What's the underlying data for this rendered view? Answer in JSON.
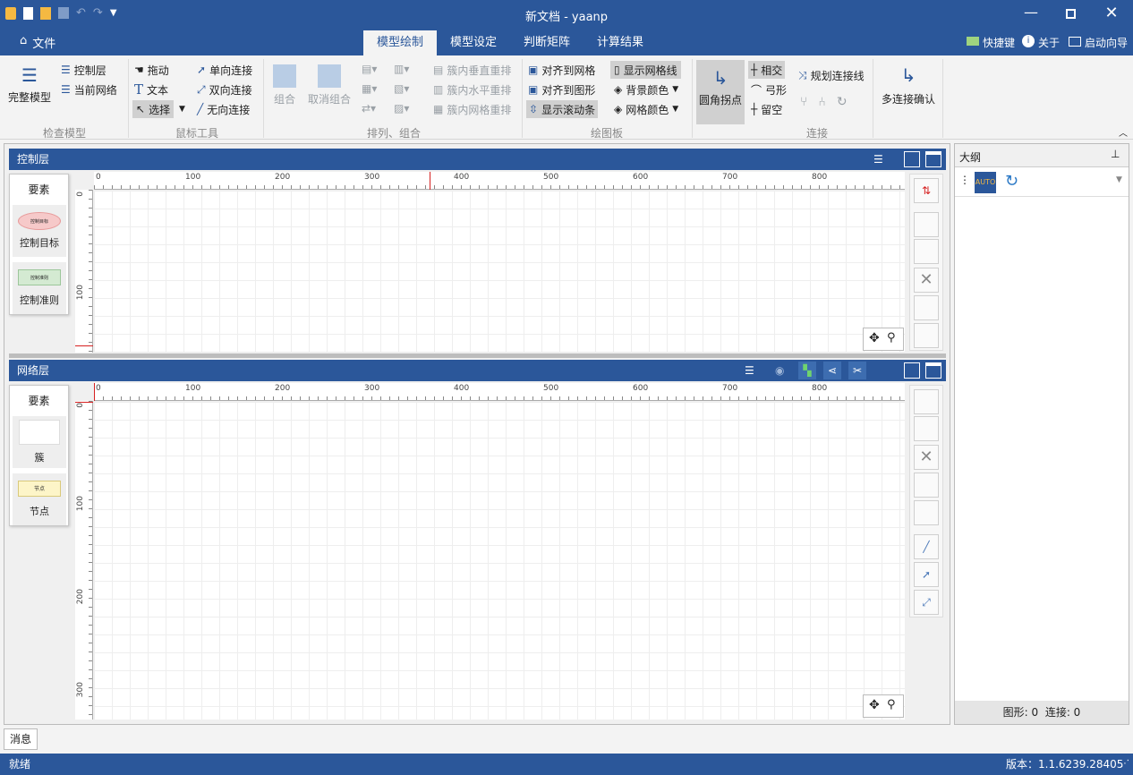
{
  "window": {
    "title": "新文档 - yaanp"
  },
  "tabs": {
    "file": "文件",
    "t1": "模型绘制",
    "t2": "模型设定",
    "t3": "判断矩阵",
    "t4": "计算结果",
    "shortcut": "快捷键",
    "about": "关于",
    "wizard": "启动向导"
  },
  "ribbon": {
    "check": {
      "complete": "完整模型",
      "ctrl_layer": "控制层",
      "cur_net": "当前网络",
      "label": "检查模型"
    },
    "mouse": {
      "drag": "拖动",
      "text": "文本",
      "select": "选择",
      "one_way": "单向连接",
      "two_way": "双向连接",
      "no_dir": "无向连接",
      "label": "鼠标工具"
    },
    "arrange": {
      "group": "组合",
      "ungroup": "取消组合",
      "vert": "簇内垂直重排",
      "horz": "簇内水平重排",
      "gridr": "簇内网格重排",
      "label": "排列、组合"
    },
    "canvas": {
      "align_grid": "对齐到网格",
      "align_shape": "对齐到图形",
      "show_scroll": "显示滚动条",
      "show_grid": "显示网格线",
      "bg_color": "背景颜色",
      "grid_color": "网格颜色",
      "label": "绘图板"
    },
    "connect": {
      "rounded": "圆角拐点",
      "intersect": "相交",
      "arc": "弓形",
      "gap": "留空",
      "plan": "规划连接线",
      "multi": "多连接确认",
      "label": "连接"
    }
  },
  "panels": {
    "control": {
      "title": "控制层",
      "elements": "要素",
      "item1": "控制目标",
      "item2": "控制准则",
      "shape1": "控制目标",
      "shape2": "控制准则"
    },
    "network": {
      "title": "网络层",
      "elements": "要素",
      "item1": "簇",
      "item2": "节点",
      "shape2": "节点"
    },
    "outline": {
      "title": "大纲",
      "shapes": "图形: 0",
      "links": "连接: 0"
    }
  },
  "ruler": {
    "h": [
      "0",
      "100",
      "200",
      "300",
      "400",
      "500",
      "600",
      "700",
      "800"
    ],
    "v_ctrl": [
      "0",
      "100"
    ],
    "v_net": [
      "0",
      "100",
      "200",
      "300"
    ]
  },
  "messages": {
    "tab": "消息"
  },
  "status": {
    "ready": "就绪",
    "version": "版本：1.1.6239.28405"
  },
  "colors": {
    "accent": "#2b579a",
    "active_tab_text": "#2b579a",
    "red_marker": "#d62020"
  }
}
